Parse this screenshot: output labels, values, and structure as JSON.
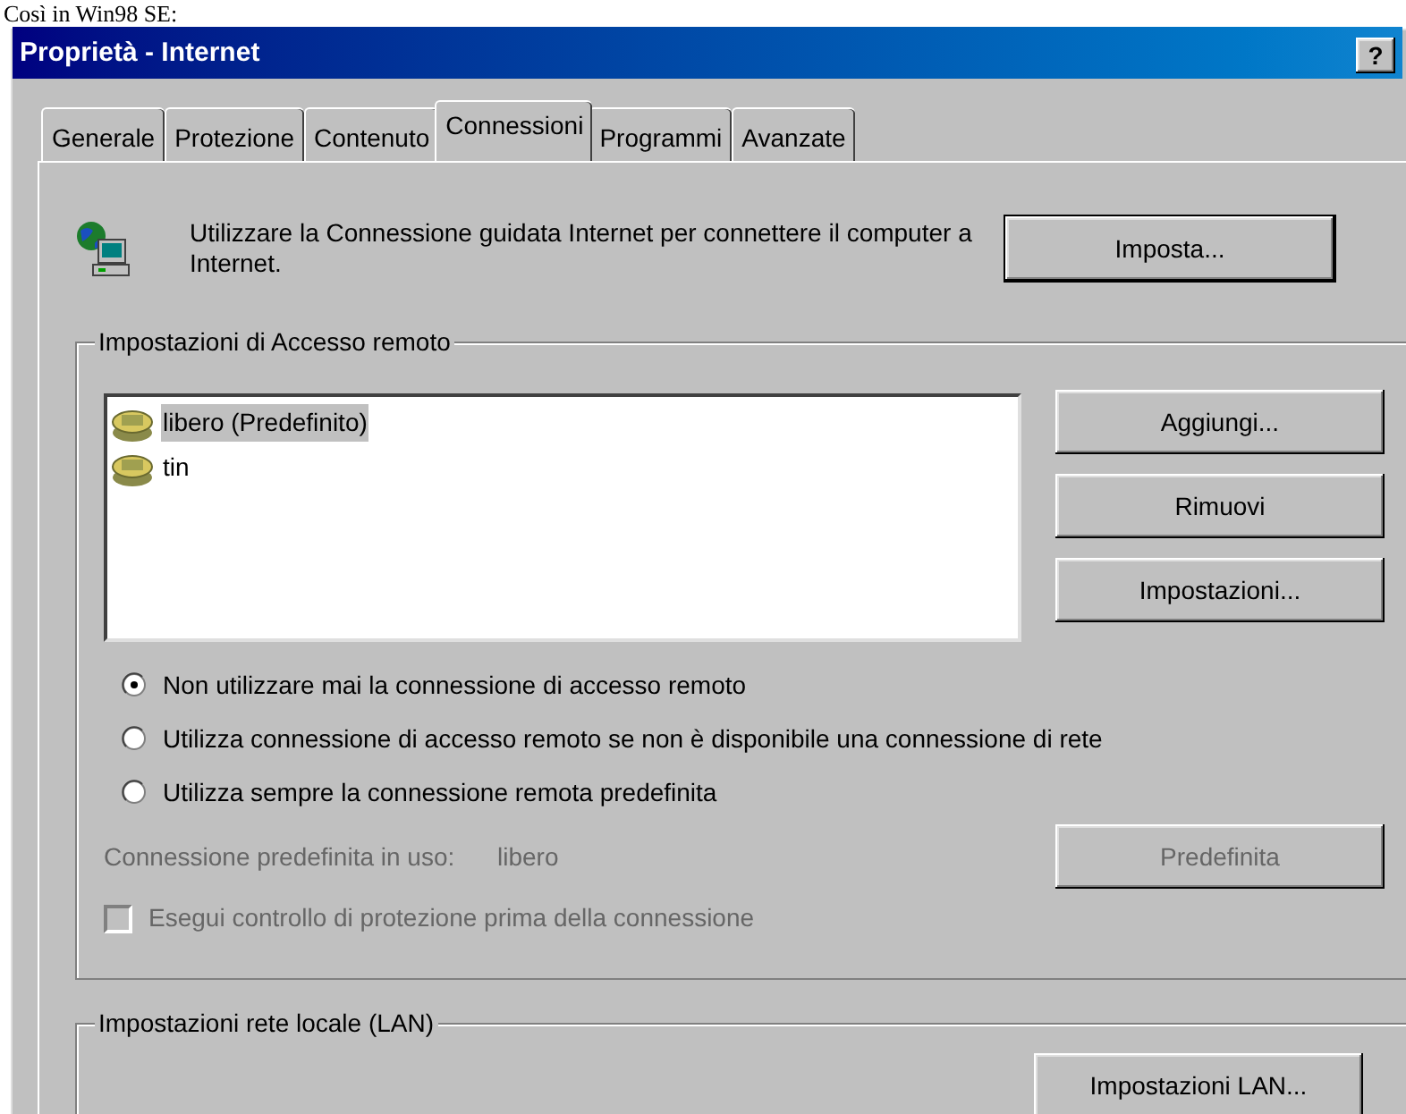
{
  "caption": "Così in Win98 SE:",
  "window": {
    "title": "Proprietà - Internet",
    "help_button": "?"
  },
  "tabs": [
    {
      "label": "Generale",
      "selected": false
    },
    {
      "label": "Protezione",
      "selected": false
    },
    {
      "label": "Contenuto",
      "selected": false
    },
    {
      "label": "Connessioni",
      "selected": true
    },
    {
      "label": "Programmi",
      "selected": false
    },
    {
      "label": "Avanzate",
      "selected": false
    }
  ],
  "wizard": {
    "text": "Utilizzare la Connessione guidata Internet per connettere il computer a Internet.",
    "button": "Imposta..."
  },
  "dialup": {
    "title": "Impostazioni di Accesso remoto",
    "connections": [
      {
        "name": "libero (Predefinito)",
        "selected": true
      },
      {
        "name": "tin",
        "selected": false
      }
    ],
    "buttons": [
      "Aggiungi...",
      "Rimuovi",
      "Impostazioni..."
    ],
    "options": [
      {
        "label": "Non utilizzare mai la connessione di accesso remoto",
        "selected": true
      },
      {
        "label": "Utilizza connessione di accesso remoto se non è disponibile una connessione di rete",
        "selected": false
      },
      {
        "label": "Utilizza sempre la connessione remota predefinita",
        "selected": false
      }
    ],
    "default_connection": {
      "label": "Connessione predefinita in uso:",
      "value": "libero",
      "button": "Predefinita",
      "disabled": true
    },
    "security_check": {
      "label": "Esegui controllo di protezione prima della connessione",
      "checked": false,
      "disabled": true
    }
  },
  "lan": {
    "title": "Impostazioni rete locale (LAN)",
    "button": "Impostazioni LAN..."
  }
}
